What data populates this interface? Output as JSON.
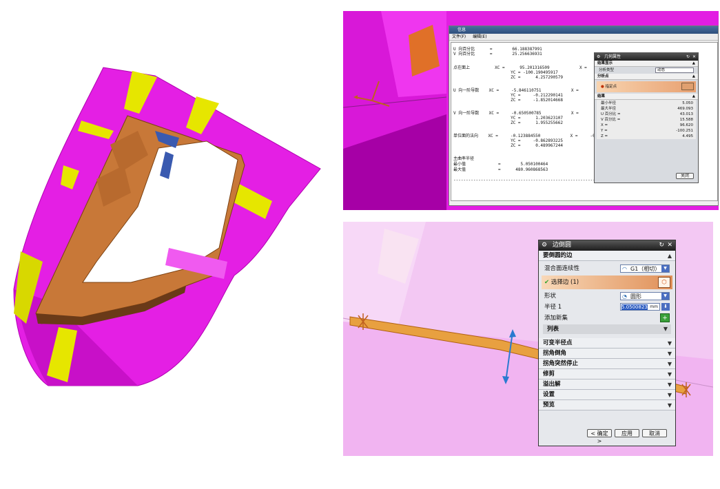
{
  "info_window": {
    "title": "信息",
    "menu": [
      "文件(F)",
      "编辑(E)"
    ],
    "lines": [
      "U 向百分比      =        66.188387991",
      "V 向百分比      =        25.256636931",
      "点在面上          XC =      95.201316509            X =",
      "                       YC = -100.190495917",
      "                       ZC =      4.257290579",
      "U 向一阶导数    XC =     -5.846110751            X =",
      "                       YC =     -0.212290141",
      "                       ZC =     -1.852014668",
      "V 向一阶导数    XC =     -0.650500785            X =",
      "                       YC =      1.203623107",
      "                       ZC =      1.955255662",
      "单位面的法向    XC =     -0.123884550            X =     -0",
      "                       YC =     -0.862893225",
      "                       ZC =      0.489967244",
      "主曲率半径",
      "最小值             =        5.050100464",
      "最大值             =      480.960868563",
      "-----------------------------------------------------------------------"
    ]
  },
  "geom_props": {
    "title": "几何属性",
    "sec_display": "结果显示",
    "analysis_type_label": "分析类型",
    "analysis_type_value": "动态",
    "sec_point": "分析点",
    "point_label": "指定点",
    "sec_result": "结果",
    "results": [
      {
        "label": "最小半径",
        "value": "5.050"
      },
      {
        "label": "最大半径",
        "value": "469.093"
      },
      {
        "label": "U 百分比 =",
        "value": "43.013"
      },
      {
        "label": "V 百分比 =",
        "value": "15.588"
      },
      {
        "label": "X =",
        "value": "96.620"
      },
      {
        "label": "Y =",
        "value": "-100.251"
      },
      {
        "label": "Z =",
        "value": "4.495"
      }
    ],
    "close_label": "关闭"
  },
  "fillet_dialog": {
    "title": "边倒圆",
    "sec_edges": "要倒圆的边",
    "continuity_label": "混合面连续性",
    "continuity_value": "G1（相切）",
    "select_edge_label": "选择边 (1)",
    "shape_label": "形状",
    "shape_value": "圆形",
    "radius_label": "半径 1",
    "radius_value": "5.0500823",
    "radius_unit": "mm",
    "add_set_label": "添加新集",
    "list_label": "列表",
    "sections": [
      "可变半径点",
      "拐角倒角",
      "拐角突然停止",
      "修剪",
      "溢出解",
      "设置",
      "预览"
    ],
    "ok_label": "< 确定 >",
    "apply_label": "应用",
    "cancel_label": "取消"
  },
  "colors": {
    "magenta": "#e81ee8",
    "yellow": "#e6e600",
    "copper": "#c87838",
    "pink_surface": "#f4b8f4"
  }
}
